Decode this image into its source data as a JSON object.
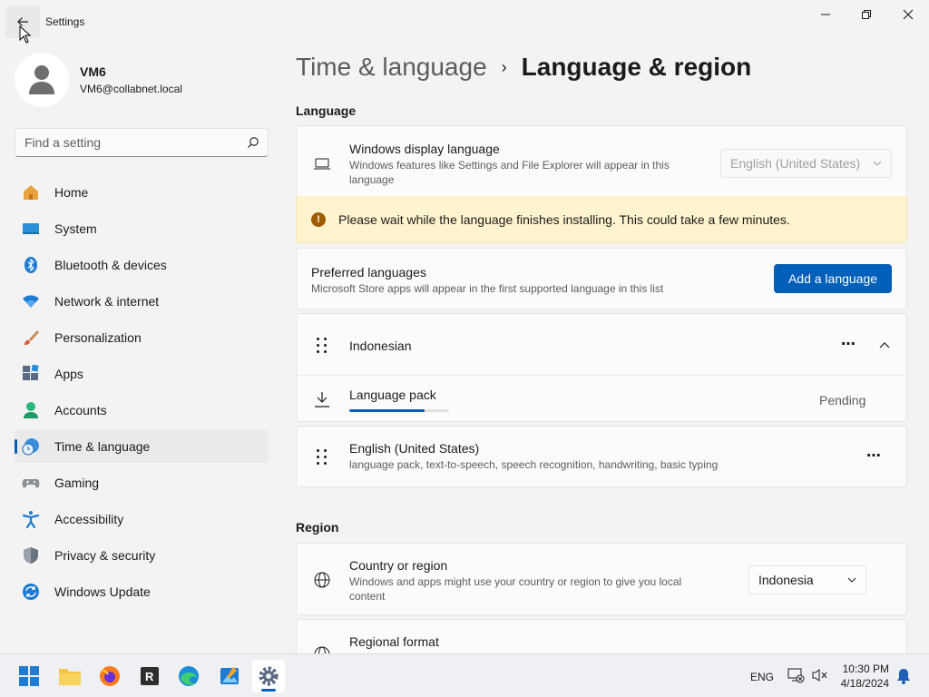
{
  "window": {
    "title": "Settings"
  },
  "profile": {
    "name": "VM6",
    "email": "VM6@collabnet.local"
  },
  "search": {
    "placeholder": "Find a setting"
  },
  "sidebar": {
    "items": [
      {
        "label": "Home",
        "icon": "home-icon"
      },
      {
        "label": "System",
        "icon": "system-icon"
      },
      {
        "label": "Bluetooth & devices",
        "icon": "bluetooth-icon"
      },
      {
        "label": "Network & internet",
        "icon": "wifi-icon"
      },
      {
        "label": "Personalization",
        "icon": "brush-icon"
      },
      {
        "label": "Apps",
        "icon": "apps-icon"
      },
      {
        "label": "Accounts",
        "icon": "accounts-icon"
      },
      {
        "label": "Time & language",
        "icon": "clock-globe-icon",
        "selected": true
      },
      {
        "label": "Gaming",
        "icon": "gamepad-icon"
      },
      {
        "label": "Accessibility",
        "icon": "accessibility-icon"
      },
      {
        "label": "Privacy & security",
        "icon": "shield-icon"
      },
      {
        "label": "Windows Update",
        "icon": "update-icon"
      }
    ]
  },
  "breadcrumb": {
    "parent": "Time & language",
    "separator": "›",
    "current": "Language & region"
  },
  "language_section": {
    "title": "Language",
    "display_language": {
      "title": "Windows display language",
      "description": "Windows features like Settings and File Explorer will appear in this language",
      "value": "English (United States)"
    },
    "warning": {
      "icon": "!",
      "text": "Please wait while the language finishes installing. This could take a few minutes."
    },
    "preferred": {
      "title": "Preferred languages",
      "description": "Microsoft Store apps will appear in the first supported language in this list",
      "add_button": "Add a language"
    },
    "languages": [
      {
        "name": "Indonesian",
        "more": "⋯"
      },
      {
        "name": "English (United States)",
        "description": "language pack, text-to-speech, speech recognition, handwriting, basic typing",
        "more": "⋯"
      }
    ],
    "language_pack": {
      "label": "Language pack",
      "status": "Pending",
      "progress": 0.75
    }
  },
  "region_section": {
    "title": "Region",
    "country": {
      "title": "Country or region",
      "description": "Windows and apps might use your country or region to give you local content",
      "value": "Indonesia"
    },
    "format": {
      "title": "Regional format"
    }
  },
  "taskbar": {
    "language": "ENG",
    "time": "10:30 PM",
    "date": "4/18/2024"
  },
  "colors": {
    "accent": "#005fb8",
    "warning_bg": "#fff4ce",
    "warning_icon": "#9d5d00"
  }
}
